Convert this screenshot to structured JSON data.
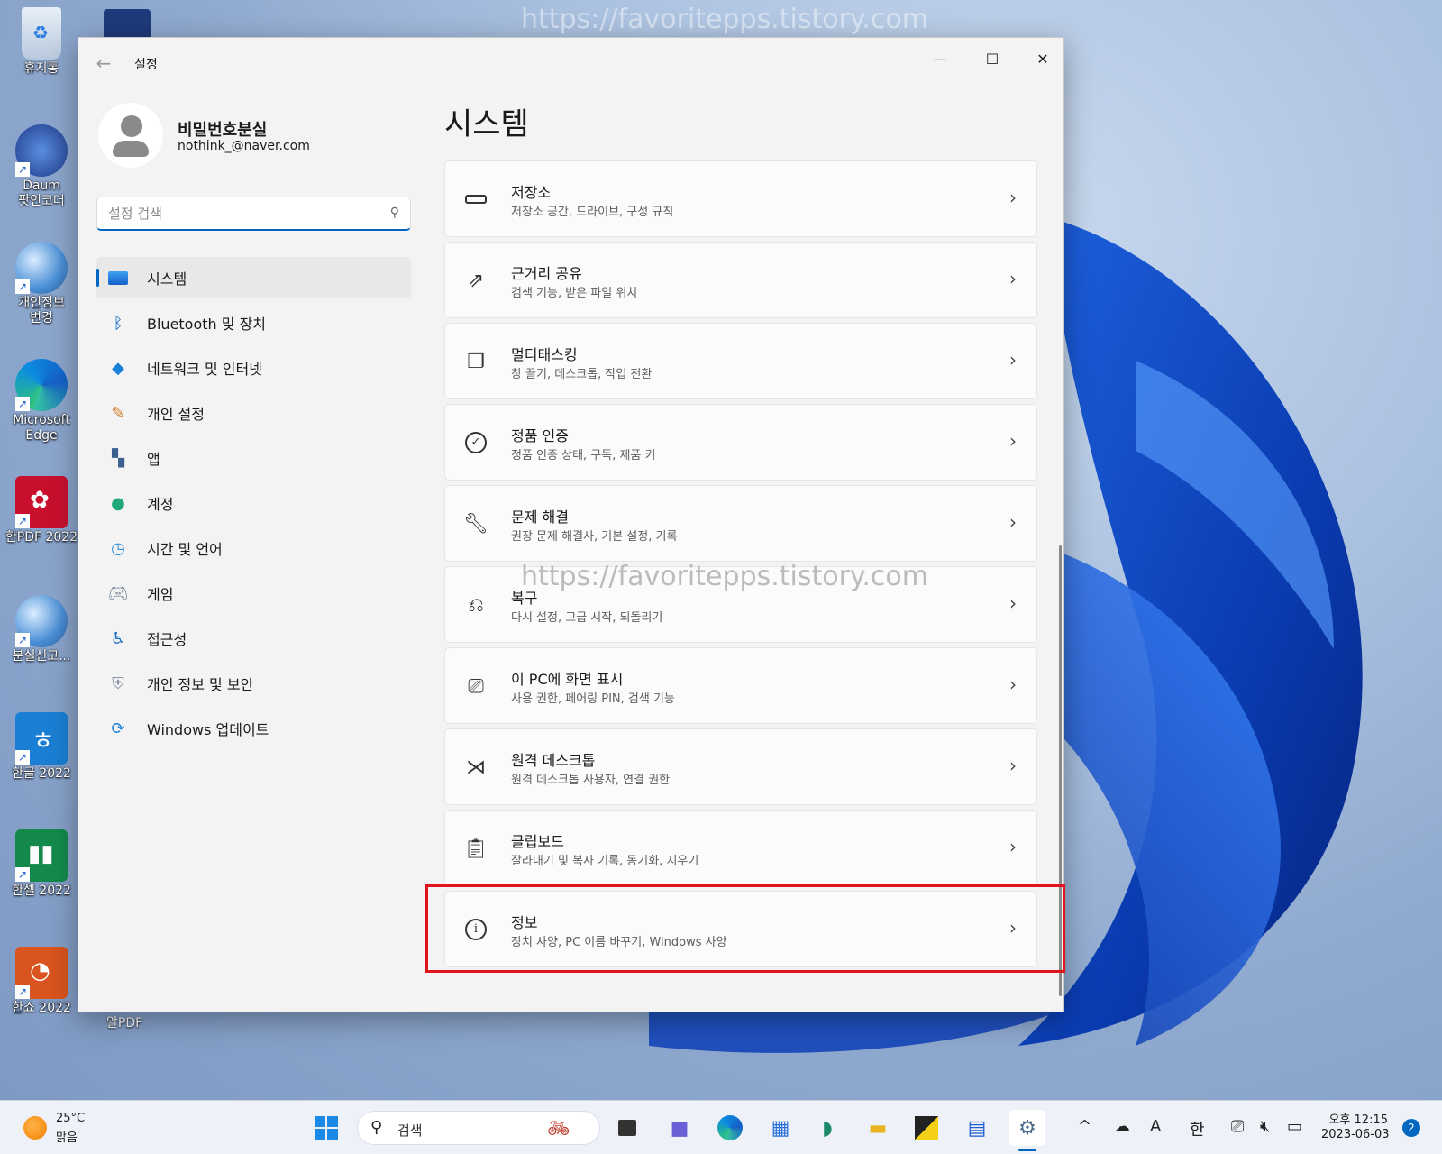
{
  "desktop": {
    "icons": [
      {
        "label": "휴지통",
        "icon": "recycle-bin-icon"
      },
      {
        "label": "Daum\n팟인코더",
        "icon": "daum-potencoder-icon"
      },
      {
        "label": "개인정보\n변경",
        "icon": "globe-icon"
      },
      {
        "label": "Microsoft\nEdge",
        "icon": "edge-icon"
      },
      {
        "label": "한PDF 2022",
        "icon": "hanpdf-icon"
      },
      {
        "label": "분실신고...",
        "icon": "globe-icon"
      },
      {
        "label": "한글 2022",
        "icon": "hangul-icon"
      },
      {
        "label": "한셀 2022",
        "icon": "hancell-icon"
      },
      {
        "label": "한쇼 2022",
        "icon": "hanshow-icon"
      }
    ],
    "extra_icon_label": "알PDF",
    "watermark": "https://favoritepps.tistory.com"
  },
  "window": {
    "title": "설정",
    "controls": {
      "minimize": "—",
      "maximize": "☐",
      "close": "✕"
    }
  },
  "profile": {
    "name": "비밀번호분실",
    "email": "nothink_@naver.com"
  },
  "search": {
    "placeholder": "설정 검색"
  },
  "nav": {
    "items": [
      {
        "label": "시스템",
        "icon": "system-icon",
        "active": true
      },
      {
        "label": "Bluetooth 및 장치",
        "icon": "bluetooth-icon"
      },
      {
        "label": "네트워크 및 인터넷",
        "icon": "wifi-icon"
      },
      {
        "label": "개인 설정",
        "icon": "brush-icon"
      },
      {
        "label": "앱",
        "icon": "apps-icon"
      },
      {
        "label": "계정",
        "icon": "account-icon"
      },
      {
        "label": "시간 및 언어",
        "icon": "clock-globe-icon"
      },
      {
        "label": "게임",
        "icon": "gamepad-icon"
      },
      {
        "label": "접근성",
        "icon": "accessibility-icon"
      },
      {
        "label": "개인 정보 및 보안",
        "icon": "shield-icon"
      },
      {
        "label": "Windows 업데이트",
        "icon": "update-icon"
      }
    ]
  },
  "main": {
    "heading": "시스템",
    "cards": [
      {
        "title": "저장소",
        "sub": "저장소 공간, 드라이브, 구성 규칙",
        "icon": "storage-icon"
      },
      {
        "title": "근거리 공유",
        "sub": "검색 기능, 받은 파일 위치",
        "icon": "share-icon"
      },
      {
        "title": "멀티태스킹",
        "sub": "창 끌기, 데스크톱, 작업 전환",
        "icon": "multitask-icon"
      },
      {
        "title": "정품 인증",
        "sub": "정품 인증 상태, 구독, 제품 키",
        "icon": "activation-icon"
      },
      {
        "title": "문제 해결",
        "sub": "권장 문제 해결사, 기본 설정, 기록",
        "icon": "wrench-icon"
      },
      {
        "title": "복구",
        "sub": "다시 설정, 고급 시작, 되돌리기",
        "icon": "recovery-icon"
      },
      {
        "title": "이 PC에 화면 표시",
        "sub": "사용 권한, 페어링 PIN, 검색 기능",
        "icon": "project-icon"
      },
      {
        "title": "원격 데스크톱",
        "sub": "원격 데스크톱 사용자, 연결 권한",
        "icon": "remote-icon"
      },
      {
        "title": "클립보드",
        "sub": "잘라내기 및 복사 기록, 동기화, 지우기",
        "icon": "clipboard-icon"
      },
      {
        "title": "정보",
        "sub": "장치 사양, PC 이름 바꾸기, Windows 사양",
        "icon": "info-icon"
      }
    ]
  },
  "taskbar": {
    "weather_temp": "25°C",
    "weather_desc": "맑음",
    "search_label": "검색",
    "tray": {
      "ime": "한",
      "font": "A",
      "chevron": "^"
    },
    "clock_time": "오후 12:15",
    "clock_date": "2023-06-03",
    "notification_count": "2"
  },
  "colors": {
    "accent": "#0067c0",
    "highlight_box": "#e0141e"
  }
}
